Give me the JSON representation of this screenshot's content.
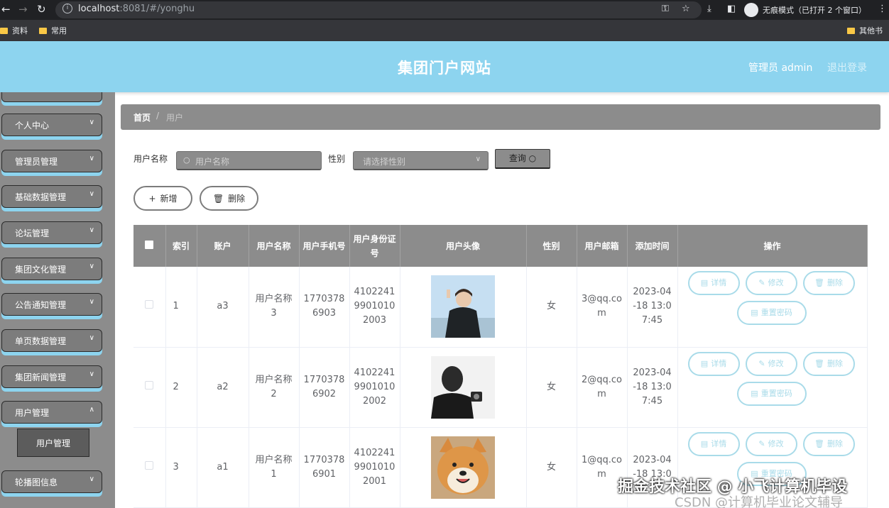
{
  "browser": {
    "url_host": "localhost",
    "url_rest": ":8081/#/yonghu",
    "incognito_label": "无痕模式（已打开 2 个窗口）",
    "bookmarks": [
      "资料",
      "常用"
    ],
    "bookmarks_right": "其他书"
  },
  "header": {
    "title": "集团门户网站",
    "admin": "管理员 admin",
    "logout": "退出登录",
    "accent_color": "#8dd4ef"
  },
  "sidebar": {
    "items": [
      {
        "label": "个人中心"
      },
      {
        "label": "管理员管理"
      },
      {
        "label": "基础数据管理"
      },
      {
        "label": "论坛管理"
      },
      {
        "label": "集团文化管理"
      },
      {
        "label": "公告通知管理"
      },
      {
        "label": "单页数据管理"
      },
      {
        "label": "集团新闻管理"
      },
      {
        "label": "用户管理"
      },
      {
        "label": "轮播图信息"
      }
    ],
    "sub_active": "用户管理"
  },
  "breadcrumb": {
    "home": "首页",
    "separator": "/",
    "current": "用户"
  },
  "filters": {
    "name_label": "用户名称",
    "name_placeholder": "用户名称",
    "gender_label": "性别",
    "gender_placeholder": "请选择性别",
    "query_label": "查询"
  },
  "actions": {
    "add": "新增",
    "delete": "删除"
  },
  "table": {
    "headers": [
      "索引",
      "账户",
      "用户名称",
      "用户手机号",
      "用户身份证号",
      "用户头像",
      "性别",
      "用户邮箱",
      "添加时间",
      "操作"
    ],
    "row_actions": {
      "detail": "详情",
      "edit": "修改",
      "delete": "删除",
      "reset": "重置密码"
    },
    "rows": [
      {
        "index": "1",
        "account": "a3",
        "name": "用户名称3",
        "phone": "17703786903",
        "id_card": "410224199010102003",
        "avatar": "photo-young-man-peace-sign",
        "gender": "女",
        "email": "3@qq.com",
        "time": "2023-04-18 13:07:45"
      },
      {
        "index": "2",
        "account": "a2",
        "name": "用户名称2",
        "phone": "17703786902",
        "id_card": "410224199010102002",
        "avatar": "photo-monochrome-man-with-camera",
        "gender": "女",
        "email": "2@qq.com",
        "time": "2023-04-18 13:07:45"
      },
      {
        "index": "3",
        "account": "a1",
        "name": "用户名称1",
        "phone": "17703786901",
        "id_card": "410224199010102001",
        "avatar": "photo-shiba-inu-dog",
        "gender": "女",
        "email": "1@qq.com",
        "time": "2023-04-18 13:0"
      }
    ]
  },
  "watermark": {
    "line1": "掘金技术社区 @ 小飞计算机毕设",
    "line2": "CSDN @计算机毕业论文辅导"
  }
}
